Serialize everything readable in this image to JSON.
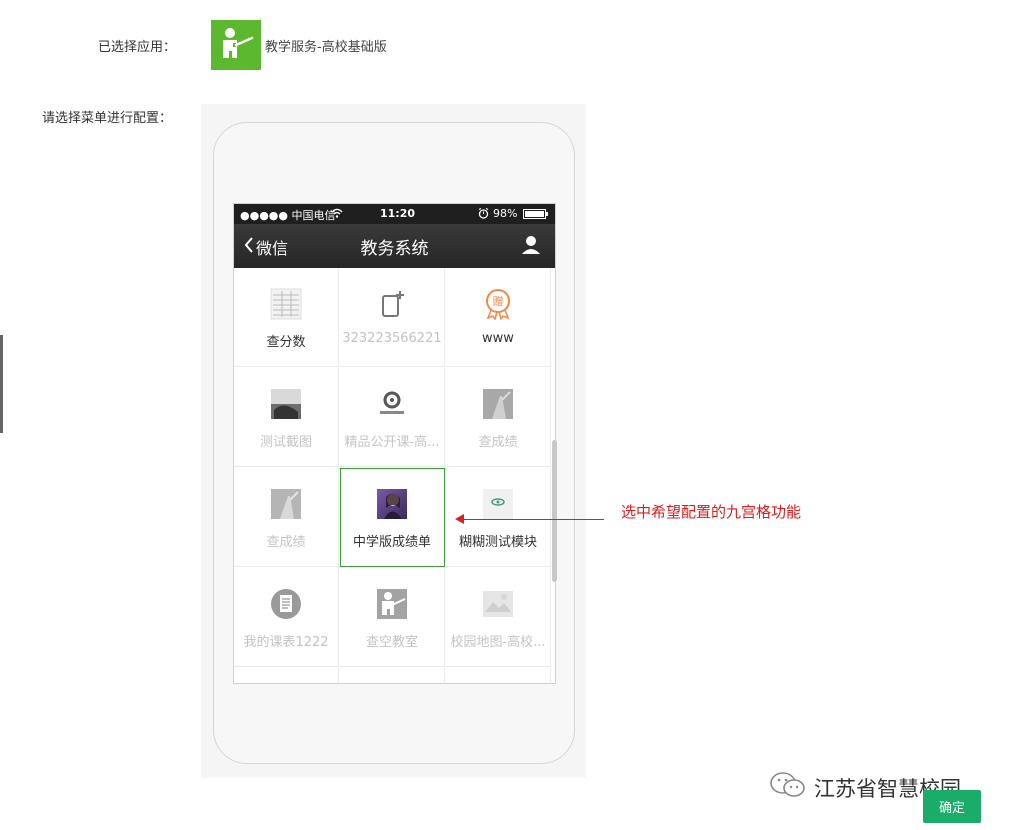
{
  "labels": {
    "selected_app": "已选择应用：",
    "select_menu": "请选择菜单进行配置："
  },
  "app": {
    "name": "教学服务-高校基础版",
    "icon": "teacher-pointer-icon",
    "color": "#5cb82e"
  },
  "phone": {
    "status_bar": {
      "carrier": "●●●●● 中国电信",
      "time": "11:20",
      "battery": "98%"
    },
    "nav": {
      "back_label": "微信",
      "title": "教务系统"
    },
    "grid": [
      {
        "label": "查分数",
        "icon": "spreadsheet-thumbnail-icon",
        "state": "active"
      },
      {
        "label": "323223566221",
        "icon": "phone-plus-icon",
        "state": "inactive"
      },
      {
        "label": "www",
        "icon": "gift-badge-icon",
        "state": "active"
      },
      {
        "label": "测试截图",
        "icon": "screenshot-thumbnail-icon",
        "state": "inactive"
      },
      {
        "label": "精品公开课-高...",
        "icon": "open-course-logo-icon",
        "state": "inactive"
      },
      {
        "label": "查成绩",
        "icon": "photo-thumbnail-icon",
        "state": "inactive"
      },
      {
        "label": "查成绩",
        "icon": "photo-thumbnail-icon",
        "state": "inactive"
      },
      {
        "label": "中学版成绩单",
        "icon": "portrait-photo-icon",
        "state": "selected"
      },
      {
        "label": "糊糊测试模块",
        "icon": "eye-thumbnail-icon",
        "state": "active"
      },
      {
        "label": "我的课表1222",
        "icon": "document-circle-icon",
        "state": "inactive"
      },
      {
        "label": "查空教室",
        "icon": "teacher-pointer-icon",
        "state": "inactive"
      },
      {
        "label": "校园地图-高校...",
        "icon": "landscape-placeholder-icon",
        "state": "inactive"
      }
    ]
  },
  "annotation": "选中希望配置的九宫格功能",
  "watermark": "江苏省智慧校园",
  "confirm_label": "确定",
  "colors": {
    "annotation": "#d82020",
    "selected_border": "#3c9e3c",
    "confirm": "#1aad6a"
  }
}
